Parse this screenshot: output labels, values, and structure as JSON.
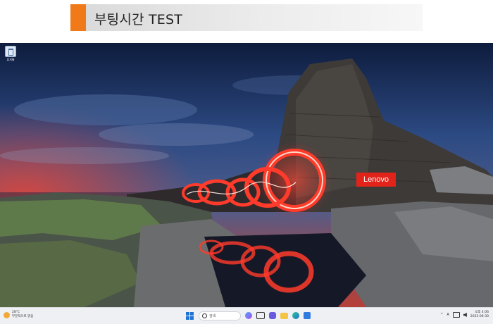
{
  "banner": {
    "title": "부팅시간 TEST"
  },
  "desktop": {
    "icons": [
      {
        "label": "휴지통",
        "icon": "recycle-bin-icon"
      }
    ],
    "brand": "Lenovo"
  },
  "taskbar": {
    "weather": {
      "temp": "28°C",
      "condition": "부분적으로 맑음",
      "icon": "weather-sun-icon"
    },
    "search_placeholder": "검색",
    "pinned": [
      {
        "icon": "start-icon"
      },
      {
        "icon": "search-icon"
      },
      {
        "icon": "copilot-icon"
      },
      {
        "icon": "task-view-icon"
      },
      {
        "icon": "chat-icon"
      },
      {
        "icon": "file-explorer-icon"
      },
      {
        "icon": "edge-icon"
      },
      {
        "icon": "store-icon"
      }
    ],
    "tray": {
      "chevron": "^",
      "ime": "A",
      "time": "오후 4:06",
      "date": "2023-06-30"
    }
  },
  "colors": {
    "accent": "#f07a1a",
    "brand_red": "#e2231a",
    "start_blue": "#1e74d6"
  }
}
